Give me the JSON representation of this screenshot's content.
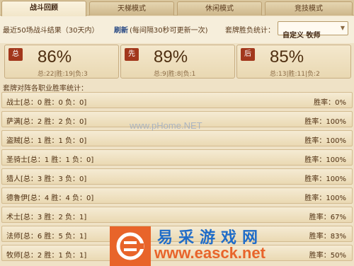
{
  "tabs": [
    {
      "label": "战斗回顾",
      "active": true
    },
    {
      "label": "天梯模式",
      "active": false
    },
    {
      "label": "休闲模式",
      "active": false
    },
    {
      "label": "竞技模式",
      "active": false
    }
  ],
  "toolbar": {
    "summary": "最近50场战斗结果（30天内）",
    "refresh": "刷新",
    "refresh_note": "(每间隔30秒可更新一次)",
    "deck_label": "套牌胜负统计：",
    "deck_select": "自定义 牧师"
  },
  "stats": [
    {
      "badge": "总",
      "pct": "86%",
      "detail": "总:22|胜:19|负:3"
    },
    {
      "badge": "先",
      "pct": "89%",
      "detail": "总:9|胜:8|负:1"
    },
    {
      "badge": "后",
      "pct": "85%",
      "detail": "总:13|胜:11|负:2"
    }
  ],
  "section_title": "套牌对阵各职业胜率统计：",
  "rows": [
    {
      "left": "战士[总：0 胜：0 负：0]",
      "right": "胜率：0%"
    },
    {
      "left": "萨满[总：2 胜：2 负：0]",
      "right": "胜率：100%"
    },
    {
      "left": "盗贼[总：1 胜：1 负：0]",
      "right": "胜率：100%"
    },
    {
      "left": "圣骑士[总：1 胜：1 负：0]",
      "right": "胜率：100%"
    },
    {
      "left": "猎人[总：3 胜：3 负：0]",
      "right": "胜率：100%"
    },
    {
      "left": "德鲁伊[总：4 胜：4 负：0]",
      "right": "胜率：100%"
    },
    {
      "left": "术士[总：3 胜：2 负：1]",
      "right": "胜率：67%"
    },
    {
      "left": "法师[总：6 胜：5 负：1]",
      "right": "胜率：83%"
    },
    {
      "left": "牧师[总：2 胜：1 负：1]",
      "right": "胜率：50%"
    }
  ],
  "watermark_mid": "www.pHome.NET",
  "logo": {
    "cn": "易采游戏网",
    "url": "www.easck.net"
  },
  "colors": {
    "badge": "#a2371c",
    "logo_orange": "#e8642a",
    "logo_blue": "#1f6cc8"
  }
}
